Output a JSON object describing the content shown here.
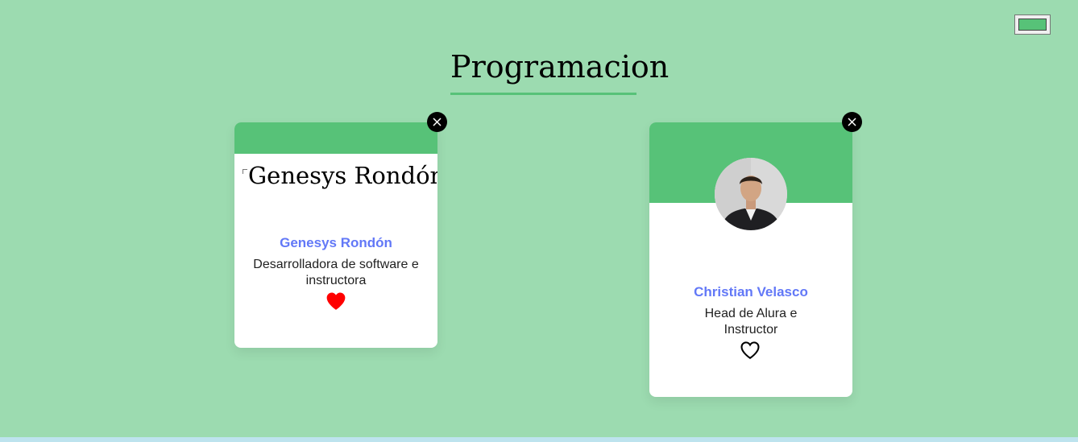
{
  "theme": {
    "page_background": "#9cdbb0",
    "accent": "#57c278",
    "name_color": "#6278f7",
    "favorite_active": "#ff0000"
  },
  "color_picker": {
    "value": "#57c278",
    "icon": "color-swatch-icon"
  },
  "section": {
    "title": "Programacion"
  },
  "cards": [
    {
      "name": "Genesys Rondón",
      "role": "Desarrolladora de software e instructora",
      "image_alt": "Genesys Rondón",
      "favorite": true,
      "close_icon": "close-icon",
      "favorite_icon": "heart-filled-icon"
    },
    {
      "name": "Christian Velasco",
      "role": "Head de Alura e Instructor",
      "favorite": false,
      "close_icon": "close-icon",
      "favorite_icon": "heart-outline-icon"
    }
  ]
}
